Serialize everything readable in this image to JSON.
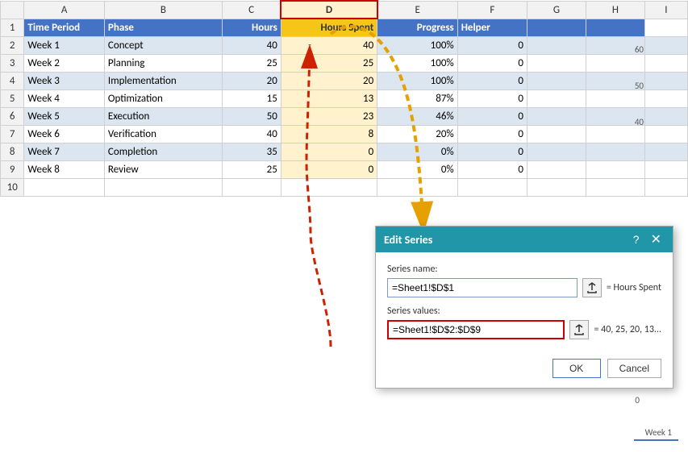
{
  "columns": {
    "letters": [
      "",
      "A",
      "B",
      "C",
      "D",
      "E",
      "F",
      "G",
      "H",
      "I"
    ],
    "widths": [
      22,
      75,
      110,
      55,
      90,
      75,
      65,
      55,
      55,
      40
    ]
  },
  "headers": {
    "time_period": "Time Period",
    "phase": "Phase",
    "hours": "Hours",
    "hours_spent": "Hours Spent",
    "progress": "Progress",
    "helper": "Helper"
  },
  "rows": [
    {
      "time_period": "Week 1",
      "phase": "Concept",
      "hours": 40,
      "hours_spent": 40,
      "progress": "100%",
      "helper": 0
    },
    {
      "time_period": "Week 2",
      "phase": "Planning",
      "hours": 25,
      "hours_spent": 25,
      "progress": "100%",
      "helper": 0
    },
    {
      "time_period": "Week 3",
      "phase": "Implementation",
      "hours": 20,
      "hours_spent": 20,
      "progress": "100%",
      "helper": 0
    },
    {
      "time_period": "Week 4",
      "phase": "Optimization",
      "hours": 15,
      "hours_spent": 13,
      "progress": "87%",
      "helper": 0
    },
    {
      "time_period": "Week 5",
      "phase": "Execution",
      "hours": 50,
      "hours_spent": 23,
      "progress": "46%",
      "helper": 0
    },
    {
      "time_period": "Week 6",
      "phase": "Verification",
      "hours": 40,
      "hours_spent": 8,
      "progress": "20%",
      "helper": 0
    },
    {
      "time_period": "Week 7",
      "phase": "Completion",
      "hours": 35,
      "hours_spent": 0,
      "progress": "0%",
      "helper": 0
    },
    {
      "time_period": "Week 8",
      "phase": "Review",
      "hours": 25,
      "hours_spent": 0,
      "progress": "0%",
      "helper": 0
    }
  ],
  "chart": {
    "y_labels": [
      "60",
      "50",
      "40"
    ],
    "x_label": "Week 1",
    "zero_label": "0"
  },
  "dialog": {
    "title": "Edit Series",
    "question_btn": "?",
    "close_btn": "✕",
    "series_name_label": "Series name:",
    "series_name_value": "=Sheet1!$D$1",
    "series_name_result": "= Hours Spent",
    "series_values_label": "Series values:",
    "series_values_value": "=Sheet1!$D$2:$D$9",
    "series_values_result": "= 40, 25, 20, 13...",
    "ok_label": "OK",
    "cancel_label": "Cancel"
  }
}
